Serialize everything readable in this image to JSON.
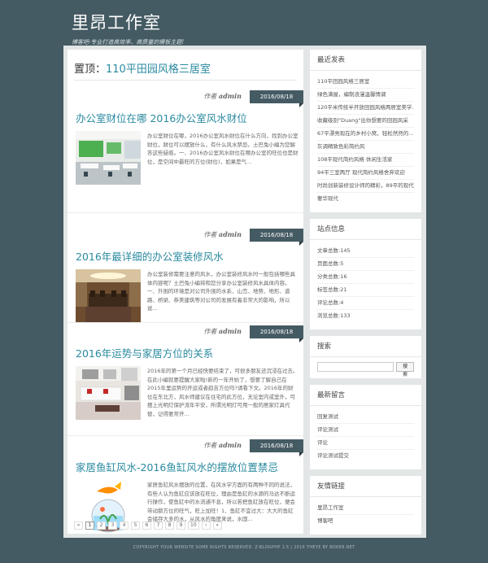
{
  "site": {
    "title": "里昂工作室",
    "tagline": "博客吧-专业打造高效率、高质量的模板主题!"
  },
  "sticky": {
    "prefix": "置顶：",
    "title": "110平田园风格三居室"
  },
  "posts": [
    {
      "author_prefix": "作者",
      "author": "admin",
      "date": "2016/08/18",
      "title": "办公室财位在哪 2016办公室风水财位",
      "excerpt": "办公室财位在哪，2016办公室风水财位在什么方向，找到办公室财位，财位可以摆放什么，有什么风水禁忌。土巴兔小编为您解答这些疑惑。一、2016办公室风水财位在哪办公室的旺位也是财位，是空间中最旺的方位(财位)，如果是气..."
    },
    {
      "author_prefix": "作者",
      "author": "admin",
      "date": "2016/08/18",
      "title": "2016年最详细的办公室装修风水",
      "excerpt": "办公室装修需要注意的风水，办公室装修风水时一般包括哪些具体内容呢？土巴兔小编将和您分享办公室装修风水具体内容。一、外围的环境是对公司外围的水系、山峦、地势、地形、道路、桥梁、恭美建筑等对公司的发展有着非常大的影响，所以说..."
    },
    {
      "author_prefix": "作者",
      "author": "admin",
      "date": "2016/08/18",
      "title": "2016年运势与家居方位的关系",
      "excerpt": "2016年的第一个月已经快要结束了，可很多朋友还沉浸在过去。在此小编就要提醒大家啦!新的一年开始了，想要了解自己在2015年里运势的开运或者趋吉方位吗?请看下文。2016年的财位在东北方，风水师建议在住宅的此方位，无论室内或室外，可摆上光明灯保护流年平安，所谓光明灯可用一般的居家灯具代替，记得要常开..."
    },
    {
      "author_prefix": "作者",
      "author": "admin",
      "date": "2016/08/18",
      "title": "家居鱼缸风水-2016鱼缸风水的摆放位置禁忌",
      "excerpt": "家居鱼缸风水摆放的位置，在风水学方面的有两种不同的说法，有些人认为鱼缸应该放在旺位，理由是鱼缸的水源的马达不断运行操作，使鱼缸中的水流通不息，所以若把鱼缸放在旺位，便会带动那方位的旺气，旺上加旺！1、鱼缸不宜过大：大大的鱼缸会储存大多的水，从风水的角度来说，水固..."
    }
  ],
  "pagination": [
    "«",
    "1",
    "2",
    "3",
    "4",
    "5",
    "6",
    "7",
    "8",
    "9",
    "10",
    "›",
    "»"
  ],
  "sidebar": {
    "recent": {
      "title": "最近发表",
      "items": [
        "110平田园风格三居室",
        "绿色满屋，编制浪漫温馨情调",
        "120平米传统半开放田园风格两居室美学…",
        "收藏级别\"Duang\"出你想要的田园风采",
        "67平漂亮现在的乡村小窝，轻松然然的…",
        "灰调精致色彩简约风",
        "108平现代简约风格 休闲生活家",
        "94平三室两厅 现代简约风格舍弃欢迎",
        "时尚创新装修设计师的精彩，89平的现代…",
        "奢华现代"
      ]
    },
    "stats": {
      "title": "站点信息",
      "items": [
        "文章总数:145",
        "页面总数:5",
        "分类总数:16",
        "标签总数:21",
        "评论总数:4",
        "浏览总数:133"
      ]
    },
    "search": {
      "title": "搜索",
      "button": "搜索",
      "value": ""
    },
    "comments": {
      "title": "最新留言",
      "items": [
        "回复测试",
        "评论测试",
        "评论",
        "评论测试提交"
      ]
    },
    "links": {
      "title": "友情链接",
      "items": [
        "里昂工作室",
        "博客吧"
      ]
    }
  },
  "footer": {
    "text": "COPYRIGHT YOUR WEBSITE SOME RIGHTS RESERVED. Z-BLOGPHP 1.5 | 2016 THEYE BY BOKE8.NET"
  },
  "colors": {
    "background": "#455b63",
    "accent": "#2a8aa0",
    "date_tag": "#455b63"
  }
}
